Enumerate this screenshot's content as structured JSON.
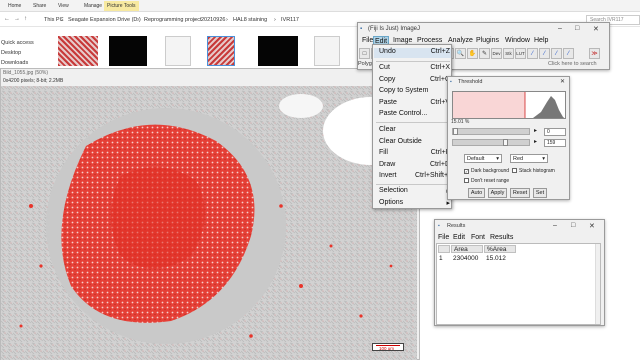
{
  "explorer": {
    "tabs": [
      "Home",
      "Share",
      "View",
      "Manage"
    ],
    "picture_tools": "Picture Tools",
    "breadcrumb": [
      "This PC",
      "Seagate Expansion Drive (D:)",
      "Reprogramming project",
      "20210926",
      "HAL8 staining",
      "IVR117"
    ],
    "search_placeholder": "Search IVR117",
    "nav_items": [
      "Quick access",
      "Desktop",
      "Downloads"
    ]
  },
  "image_window": {
    "title": "Bild_1055.jpg (50%)",
    "info": "0x4200 pixels; 8-bit; 2.2MB",
    "scale_bar": "100 um"
  },
  "imagej": {
    "title": "(Fiji Is Just) ImageJ",
    "menus": [
      "File",
      "Edit",
      "Image",
      "Process",
      "Analyze",
      "Plugins",
      "Window",
      "Help"
    ],
    "active_menu": "Edit",
    "status_left": "Polygo",
    "status_right": "Click here to search",
    "tools": [
      "□",
      "○",
      "⬠",
      "∿",
      "∠",
      "+",
      "✶",
      "A",
      "🔍",
      "✋",
      "✎",
      "Dev",
      "Stk",
      "LUT",
      "⁄",
      "⁄",
      "⁄",
      "⁄",
      "≫"
    ]
  },
  "edit_menu": {
    "items": [
      {
        "label": "Undo",
        "shortcut": "Ctrl+Z"
      },
      {
        "label": "Cut",
        "shortcut": "Ctrl+X"
      },
      {
        "label": "Copy",
        "shortcut": "Ctrl+C"
      },
      {
        "label": "Copy to System",
        "shortcut": ""
      },
      {
        "label": "Paste",
        "shortcut": "Ctrl+V"
      },
      {
        "label": "Paste Control...",
        "shortcut": ""
      },
      {
        "label": "Clear",
        "shortcut": ""
      },
      {
        "label": "Clear Outside",
        "shortcut": ""
      },
      {
        "label": "Fill",
        "shortcut": "Ctrl+F"
      },
      {
        "label": "Draw",
        "shortcut": "Ctrl+D"
      },
      {
        "label": "Invert",
        "shortcut": "Ctrl+Shift+I"
      },
      {
        "label": "Selection",
        "shortcut": "▸"
      },
      {
        "label": "Options",
        "shortcut": "▸"
      }
    ]
  },
  "threshold": {
    "title": "Threshold",
    "percent": "15.01 %",
    "min_value": "0",
    "max_value": "159",
    "method": "Default",
    "mode": "Red",
    "dark_background": "Dark background",
    "stack_histogram": "Stack histogram",
    "dont_reset": "Don't reset range",
    "buttons": [
      "Auto",
      "Apply",
      "Reset",
      "Set"
    ]
  },
  "results": {
    "title": "Results",
    "menus": [
      "File",
      "Edit",
      "Font",
      "Results"
    ],
    "columns": [
      " ",
      "Area",
      "%Area"
    ],
    "rows": [
      [
        "1",
        "2304000",
        "15.012"
      ]
    ]
  }
}
